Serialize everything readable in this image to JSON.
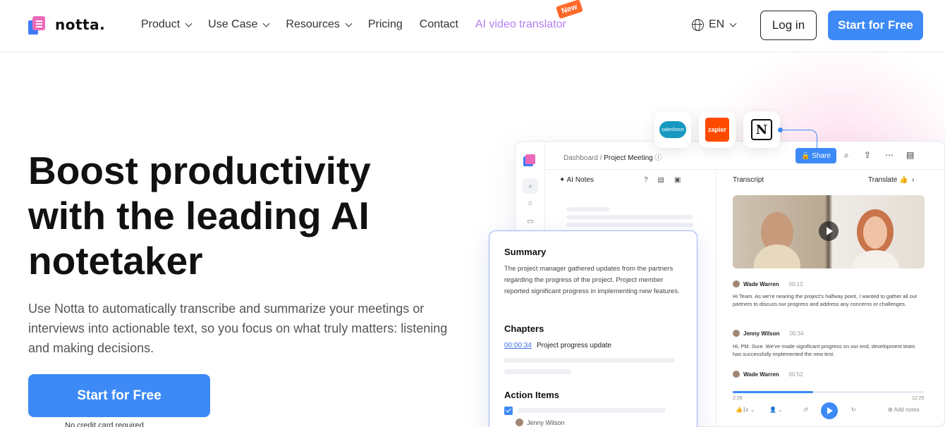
{
  "nav": {
    "brand": "notta.",
    "menu": [
      {
        "label": "Product",
        "dropdown": true
      },
      {
        "label": "Use Case",
        "dropdown": true
      },
      {
        "label": "Resources",
        "dropdown": true
      },
      {
        "label": "Pricing",
        "dropdown": false
      },
      {
        "label": "Contact",
        "dropdown": false
      }
    ],
    "ai_link": "AI video translator",
    "new_badge": "New",
    "language": "EN",
    "login": "Log in",
    "start": "Start for Free"
  },
  "hero": {
    "title_lines": [
      "Boost productivity",
      "with the leading AI",
      "notetaker"
    ],
    "subtitle": "Use Notta to automatically transcribe and summarize your meetings or interviews into actionable text, so you focus on what truly matters: listening and making decisions.",
    "cta": "Start for Free",
    "cta_note": "No credit card required"
  },
  "integrations": {
    "salesforce": "salesforce",
    "zapier": "zapier",
    "notion": "N"
  },
  "app": {
    "breadcrumb_root": "Dashboard",
    "breadcrumb_sep": "/",
    "breadcrumb_page": "Project Meeting",
    "share": "Share",
    "ai_notes": "AI Notes",
    "transcript": "Transcript",
    "translate": "Translate",
    "transcript_entries": [
      {
        "speaker": "Wade Warren",
        "time": "00:12",
        "text": "Hi Team. As we're nearing the project's halfway point, I wanted to gather all our partners to discuss our progress and address any concerns or challenges."
      },
      {
        "speaker": "Jenny Wilson",
        "time": "00:34",
        "text": "Hi, PM. Sure. We've made significant progress on our end, development team has successfully implemented the new test."
      },
      {
        "speaker": "Wade Warren",
        "time": "00:52",
        "text": ""
      }
    ],
    "player": {
      "elapsed": "2:26",
      "total": "12:25",
      "speed": "1x",
      "add_notes": "Add notes",
      "progress_fraction": 0.42
    }
  },
  "summary_card": {
    "summary_title": "Summary",
    "summary_text": "The project manager gathered updates from the partners regarding the progress of the project. Project member reported significant progress in implementing new features.",
    "chapters_title": "Chapters",
    "chapter_time": "00:00:34",
    "chapter_label": "Project progress update",
    "action_title": "Action Items",
    "action_assignee": "Jenny Wilson"
  },
  "colors": {
    "accent": "#3d8af7",
    "ai_link": "#b57ff5",
    "badge": "#ff6a2a"
  }
}
